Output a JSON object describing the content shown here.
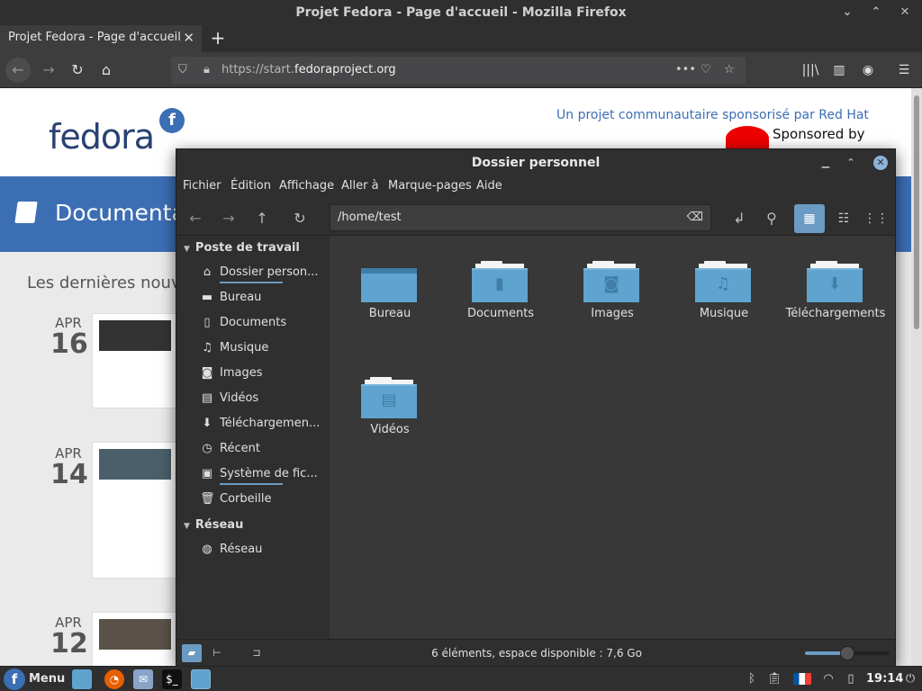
{
  "firefox": {
    "window_title": "Projet Fedora - Page d'accueil - Mozilla Firefox",
    "tab_label": "Projet Fedora - Page d'accueil",
    "url_prefix": "https://start.",
    "url_domain": "fedoraproject.org"
  },
  "fedora_page": {
    "logo_text": "fedora",
    "tagline": "Un projet communautaire sponsorisé par Red Hat",
    "sponsor": "Sponsored by",
    "band_title": "Documentation",
    "latest": "Les dernières nouvelles",
    "posts": [
      {
        "month": "APR",
        "day": "16"
      },
      {
        "month": "APR",
        "day": "14"
      },
      {
        "month": "APR",
        "day": "12"
      }
    ]
  },
  "nemo": {
    "title": "Dossier personnel",
    "menus": [
      "Fichier",
      "Édition",
      "Affichage",
      "Aller à",
      "Marque-pages",
      "Aide"
    ],
    "path": "/home/test",
    "sidebar": {
      "section_places": "Poste de travail",
      "places": [
        {
          "label": "Dossier person...",
          "icon": "home-icon"
        },
        {
          "label": "Bureau",
          "icon": "desktop-icon"
        },
        {
          "label": "Documents",
          "icon": "document-icon"
        },
        {
          "label": "Musique",
          "icon": "music-icon"
        },
        {
          "label": "Images",
          "icon": "camera-icon"
        },
        {
          "label": "Vidéos",
          "icon": "film-icon"
        },
        {
          "label": "Téléchargemen...",
          "icon": "download-icon"
        },
        {
          "label": "Récent",
          "icon": "history-icon"
        },
        {
          "label": "Système de fic...",
          "icon": "drive-icon"
        },
        {
          "label": "Corbeille",
          "icon": "trash-icon"
        }
      ],
      "section_network": "Réseau",
      "network": [
        {
          "label": "Réseau",
          "icon": "globe-icon"
        }
      ]
    },
    "folders": [
      {
        "label": "Bureau",
        "icon": "desktop-folder-icon"
      },
      {
        "label": "Documents",
        "icon": "documents-folder-icon"
      },
      {
        "label": "Images",
        "icon": "pictures-folder-icon"
      },
      {
        "label": "Musique",
        "icon": "music-folder-icon"
      },
      {
        "label": "Téléchargements",
        "icon": "downloads-folder-icon"
      },
      {
        "label": "Vidéos",
        "icon": "videos-folder-icon"
      }
    ],
    "status_text": "6 éléments, espace disponible : 7,6 Go",
    "zoom_level": 0.5,
    "accent": "#6b9bc3",
    "folder_color": "#5fa3cf"
  },
  "taskbar": {
    "menu_label": "Menu",
    "clock": "19:14"
  }
}
